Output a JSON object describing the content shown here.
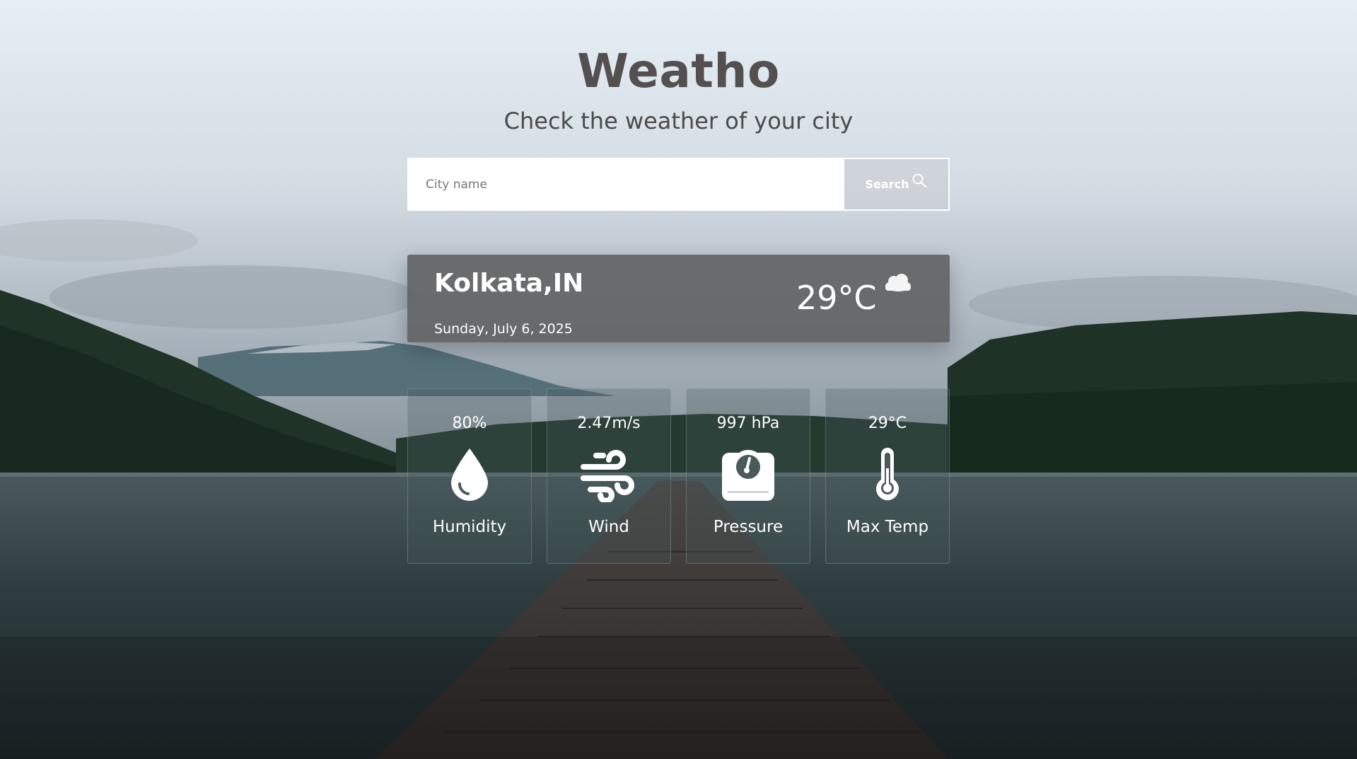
{
  "header": {
    "title": "Weatho",
    "subtitle": "Check the weather of your city"
  },
  "search": {
    "placeholder": "City name",
    "value": "",
    "button_label": "Search",
    "button_icon": "search-icon"
  },
  "current": {
    "city": "Kolkata,IN",
    "date": "Sunday, July 6, 2025",
    "temperature": "29°C",
    "condition_icon": "cloud-moon-icon"
  },
  "stats": [
    {
      "value": "80%",
      "label": "Humidity",
      "icon": "water-drop-icon"
    },
    {
      "value": "2.47m/s",
      "label": "Wind",
      "icon": "wind-icon"
    },
    {
      "value": "997 hPa",
      "label": "Pressure",
      "icon": "pressure-gauge-icon"
    },
    {
      "value": "29°C",
      "label": "Max Temp",
      "icon": "thermometer-icon"
    }
  ],
  "colors": {
    "title": "#545050",
    "card_background": "#5f5f5f",
    "text_on_dark": "#ffffff"
  }
}
